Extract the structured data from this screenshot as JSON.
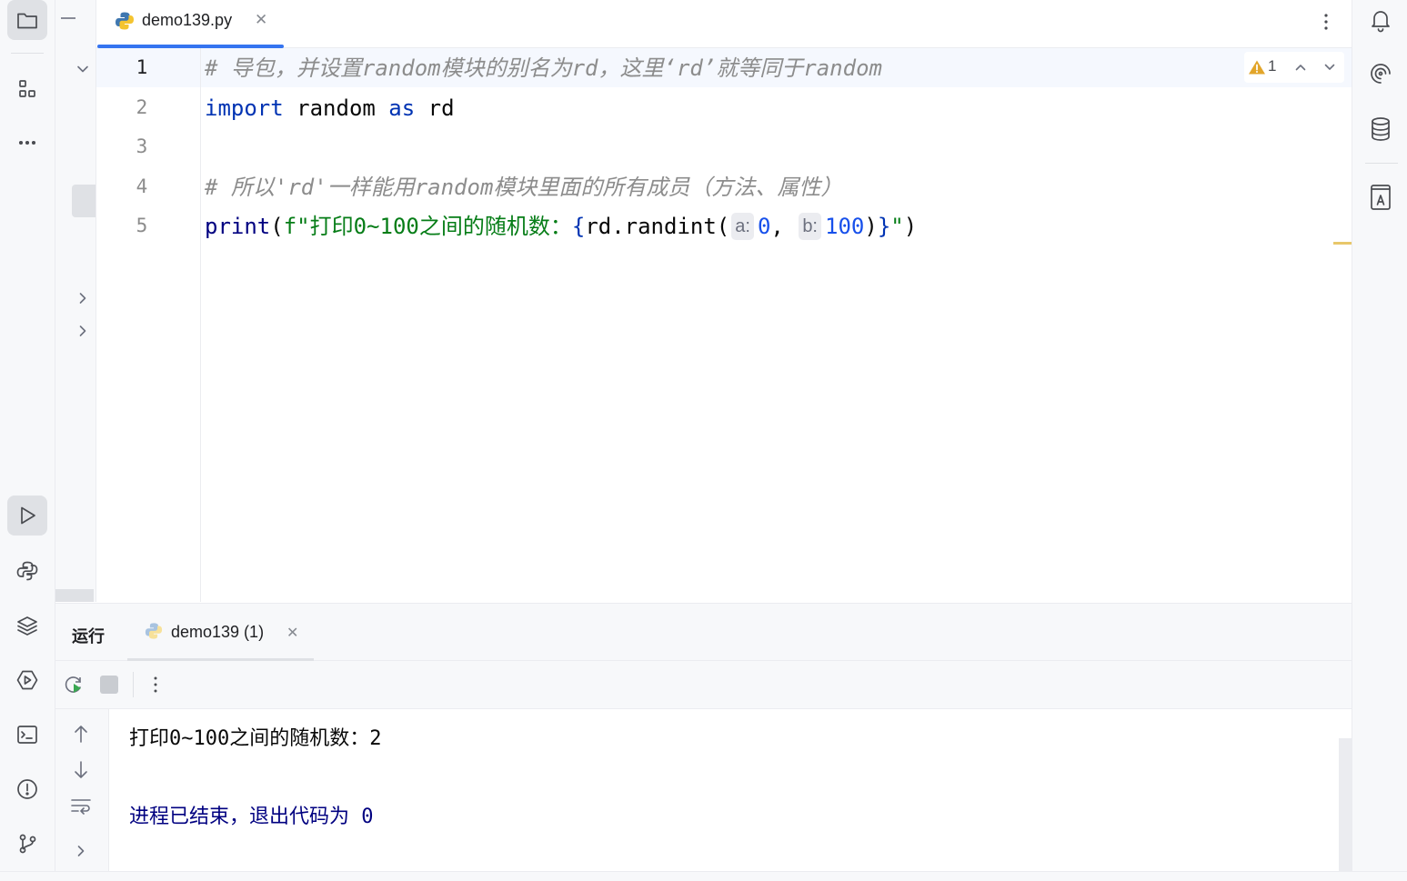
{
  "tabs": [
    {
      "label": "demo139.py",
      "active": true
    }
  ],
  "editor": {
    "lines": [
      {
        "no": "1",
        "segments": [
          {
            "cls": "cmt",
            "text": "# 导包，并设置random模块的别名为rd，这里‘rd’就等同于random"
          }
        ]
      },
      {
        "no": "2",
        "segments": [
          {
            "cls": "kw",
            "text": "import"
          },
          {
            "cls": "",
            "text": " random "
          },
          {
            "cls": "kw",
            "text": "as"
          },
          {
            "cls": "",
            "text": " rd"
          }
        ]
      },
      {
        "no": "3",
        "segments": []
      },
      {
        "no": "4",
        "segments": [
          {
            "cls": "cmt",
            "text": "# 所以'rd'一样能用random模块里面的所有成员（方法、属性）"
          }
        ]
      },
      {
        "no": "5",
        "segments": [
          {
            "cls": "fn",
            "text": "print"
          },
          {
            "cls": "",
            "text": "("
          },
          {
            "cls": "str",
            "text": "f\"打印0~100之间的随机数："
          },
          {
            "cls": "kw",
            "text": "{"
          },
          {
            "cls": "",
            "text": "rd.randint("
          },
          {
            "cls": "hint",
            "text": "a:"
          },
          {
            "cls": "num",
            "text": "0"
          },
          {
            "cls": "",
            "text": ", "
          },
          {
            "cls": "hint",
            "text": "b:"
          },
          {
            "cls": "num",
            "text": "100"
          },
          {
            "cls": "",
            "text": ")"
          },
          {
            "cls": "kw",
            "text": "}"
          },
          {
            "cls": "str",
            "text": "\""
          },
          {
            "cls": "",
            "text": ")"
          }
        ]
      }
    ],
    "warning_count": "1"
  },
  "run_panel": {
    "title": "运行",
    "tab_label": "demo139 (1)",
    "console": {
      "output_line": "打印0~100之间的随机数：2",
      "exit_line": "进程已结束，退出代码为 0"
    }
  },
  "colors": {
    "accent": "#3574f0",
    "keyword": "#0033b3",
    "string": "#067d17",
    "number": "#1750eb",
    "comment": "#8c8c8c",
    "console_system": "#000080"
  },
  "icons": {
    "left_strip": [
      "project-icon",
      "structure-icon",
      "more-icon",
      "run-icon",
      "python-console-icon",
      "layers-icon",
      "services-icon",
      "terminal-icon",
      "problems-icon",
      "git-icon"
    ],
    "right_strip": [
      "notifications-icon",
      "ai-assistant-icon",
      "database-icon",
      "text-icon"
    ]
  }
}
